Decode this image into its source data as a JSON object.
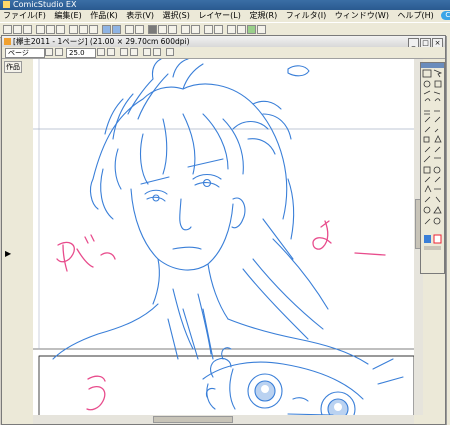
{
  "app": {
    "title": "ComicStudio EX",
    "logo_text": "ComicStudio"
  },
  "menu": [
    {
      "label": "ファイル(F)"
    },
    {
      "label": "編集(E)"
    },
    {
      "label": "作品(K)"
    },
    {
      "label": "表示(V)"
    },
    {
      "label": "選択(S)"
    },
    {
      "label": "レイヤー(L)"
    },
    {
      "label": "定規(R)"
    },
    {
      "label": "フィルタ(I)"
    },
    {
      "label": "ウィンドウ(W)"
    },
    {
      "label": "ヘルプ(H)"
    }
  ],
  "document": {
    "title": "[欅主2011 - 1ページ] (21.00 × 29.70cm 600dpi)"
  },
  "viewbar": {
    "page_label": "ページ",
    "zoom": "25.0"
  },
  "sidebar": {
    "tab_label": "作品"
  },
  "colors": {
    "line_blue": "#3a7fd8",
    "note_pink": "#e84c8c",
    "titlebar": "#2a5a90",
    "chrome": "#ece9d8"
  },
  "icons": [
    "app-icon",
    "new-icon",
    "open-icon",
    "save-icon",
    "print-icon",
    "undo-icon",
    "redo-icon",
    "cut-icon",
    "copy-icon",
    "paste-icon",
    "zoom-in-icon",
    "zoom-out-icon",
    "rotate-icon",
    "grid-icon",
    "ruler-icon",
    "pen-tool-icon",
    "eraser-icon",
    "hand-icon",
    "magnifier-icon",
    "text-tool-icon",
    "fill-tool-icon",
    "select-tool-icon",
    "lasso-icon",
    "color-swatch-icon"
  ]
}
